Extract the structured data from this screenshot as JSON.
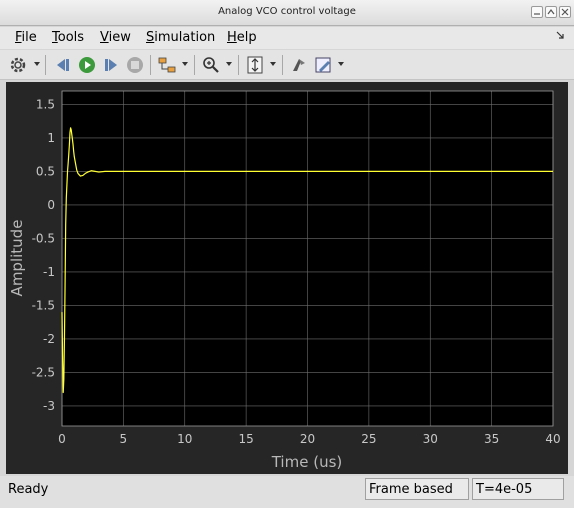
{
  "window": {
    "title": "Analog VCO control voltage"
  },
  "menu": {
    "file": {
      "u": "F",
      "rest": "ile"
    },
    "tools": {
      "u": "T",
      "rest": "ools"
    },
    "view": {
      "u": "V",
      "rest": "iew"
    },
    "simulation": {
      "u": "S",
      "rest": "imulation"
    },
    "help": {
      "u": "H",
      "rest": "elp"
    }
  },
  "toolbar": {
    "icons": [
      "settings-icon",
      "step-back-icon",
      "run-icon",
      "step-forward-icon",
      "stop-icon",
      "signal-select-icon",
      "zoom-icon",
      "scale-axes-icon",
      "highlight-icon",
      "style-icon"
    ]
  },
  "chart_data": {
    "type": "line",
    "xlabel": "Time (us)",
    "ylabel": "Amplitude",
    "xlim": [
      0,
      40
    ],
    "ylim": [
      -3.3,
      1.7
    ],
    "xticks": [
      "0",
      "5",
      "10",
      "15",
      "20",
      "25",
      "30",
      "35",
      "40"
    ],
    "yticks": [
      "1.5",
      "1",
      "0.5",
      "0",
      "-0.5",
      "-1",
      "-1.5",
      "-2",
      "-2.5",
      "-3"
    ],
    "grid": true,
    "series": [
      {
        "color": "#ffff33",
        "x": [
          0,
          0.05,
          0.1,
          0.15,
          0.2,
          0.25,
          0.3,
          0.35,
          0.4,
          0.45,
          0.5,
          0.55,
          0.6,
          0.65,
          0.7,
          0.75,
          0.8,
          0.85,
          0.9,
          0.95,
          1.0,
          1.1,
          1.2,
          1.3,
          1.5,
          1.7,
          1.9,
          2.1,
          2.4,
          2.7,
          3.0,
          3.5,
          4.0,
          5.0,
          10,
          20,
          30,
          40
        ],
        "y": [
          -1.6,
          -2.3,
          -2.8,
          -2.6,
          -2.0,
          -1.2,
          -0.3,
          0.1,
          0.3,
          0.5,
          0.62,
          0.75,
          0.9,
          1.08,
          1.15,
          1.12,
          1.05,
          0.98,
          0.9,
          0.8,
          0.72,
          0.62,
          0.52,
          0.47,
          0.43,
          0.44,
          0.47,
          0.49,
          0.51,
          0.5,
          0.49,
          0.5,
          0.5,
          0.5,
          0.5,
          0.5,
          0.5,
          0.5
        ]
      }
    ]
  },
  "status": {
    "state": "Ready",
    "mode": "Frame based",
    "time": "T=4e-05"
  }
}
